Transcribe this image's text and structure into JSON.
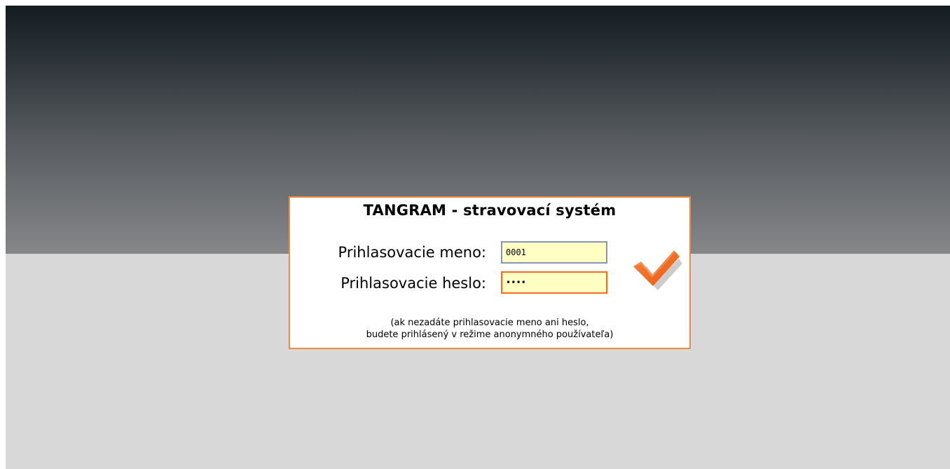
{
  "login": {
    "title": "TANGRAM - stravovací systém",
    "username_label": "Prihlasovacie meno:",
    "username_value": "0001",
    "password_label": "Prihlasovacie heslo:",
    "password_value": "pass",
    "submit_icon": "checkmark-icon",
    "note_line1": "(ak nezadáte prihlasovacie meno ani heslo,",
    "note_line2": "budete prihlásený v režime anonymného používateľa)"
  },
  "colors": {
    "accent_border": "#f08a3e",
    "input_background": "#ffffc4",
    "check_orange": "#f26e1f",
    "page_background": "#d8d8d8",
    "header_gradient_top": "#141c22",
    "header_gradient_bottom": "#868789"
  }
}
